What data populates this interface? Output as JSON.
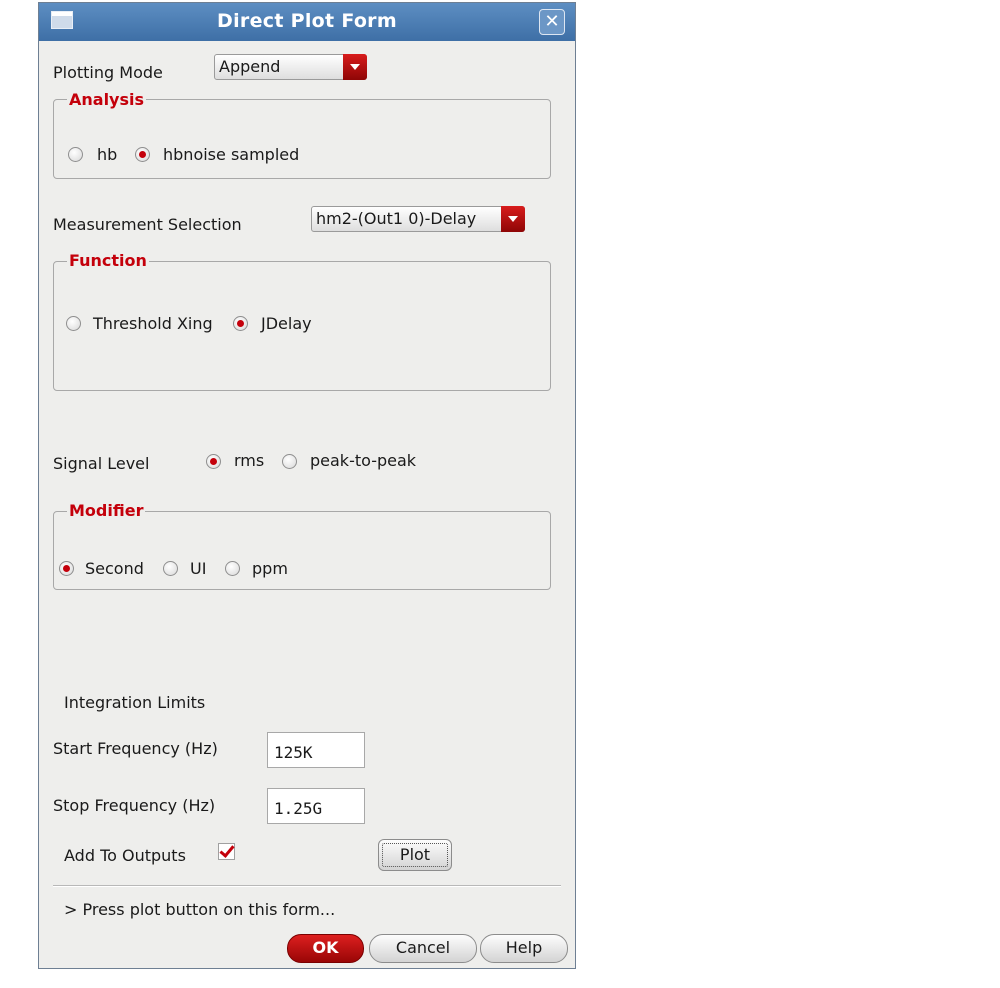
{
  "window": {
    "title": "Direct Plot Form"
  },
  "plotting_mode": {
    "label": "Plotting Mode",
    "value": "Append"
  },
  "analysis": {
    "title": "Analysis",
    "options": [
      "hb",
      "hbnoise sampled"
    ],
    "selected": "hbnoise sampled"
  },
  "measurement": {
    "label": "Measurement Selection",
    "value": "hm2-(Out1 0)-Delay"
  },
  "function": {
    "title": "Function",
    "options": [
      "Threshold Xing",
      "JDelay"
    ],
    "selected": "JDelay"
  },
  "signal_level": {
    "label": "Signal Level",
    "options": [
      "rms",
      "peak-to-peak"
    ],
    "selected": "rms"
  },
  "modifier": {
    "title": "Modifier",
    "options": [
      "Second",
      "UI",
      "ppm"
    ],
    "selected": "Second"
  },
  "integration": {
    "title": "Integration Limits",
    "start_label": "Start Frequency (Hz)",
    "start_value": "125K",
    "stop_label": "Stop Frequency (Hz)",
    "stop_value": "1.25G"
  },
  "add_to_outputs": {
    "label": "Add To Outputs",
    "checked": true
  },
  "plot_button": "Plot",
  "status": "> Press plot button on this form...",
  "buttons": {
    "ok": "OK",
    "cancel": "Cancel",
    "help": "Help"
  },
  "colors": {
    "accent": "#c4000b",
    "titlebar": "#4a7db5",
    "window_bg": "#eeeeec"
  }
}
